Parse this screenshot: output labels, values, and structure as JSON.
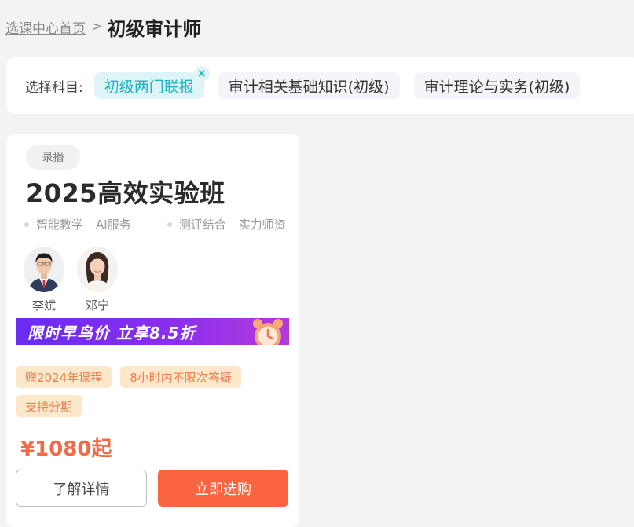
{
  "breadcrumb": {
    "home_label": "选课中心首页",
    "separator": ">",
    "current": "初级审计师"
  },
  "filter": {
    "label": "选择科目:",
    "subjects": [
      {
        "label": "初级两门联报",
        "active": true
      },
      {
        "label": "审计相关基础知识(初级)",
        "active": false
      },
      {
        "label": "审计理论与实务(初级)",
        "active": false
      }
    ],
    "remove_icon": "×"
  },
  "course": {
    "badge": "录播",
    "title": "2025高效实验班",
    "features": [
      [
        "智能教学",
        "AI服务"
      ],
      [
        "测评结合",
        "实力师资"
      ]
    ],
    "teachers": [
      {
        "name": "李斌",
        "avatar_icon": "male-teacher-avatar"
      },
      {
        "name": "邓宁",
        "avatar_icon": "female-teacher-avatar"
      }
    ],
    "promo": {
      "text": "限时早鸟价 立享8.5折",
      "icon": "alarm-clock-icon"
    },
    "tags": [
      "赠2024年课程",
      "8小时内不限次答疑",
      "支持分期"
    ],
    "price": "¥1080起",
    "detail_button": "了解详情",
    "buy_button": "立即选购"
  },
  "colors": {
    "accent_teal": "#22b3c2",
    "price_orange": "#f06a45",
    "buy_button": "#fa6441",
    "promo_purple": "#7a2cf1",
    "tag_bg": "#fde8cc"
  }
}
